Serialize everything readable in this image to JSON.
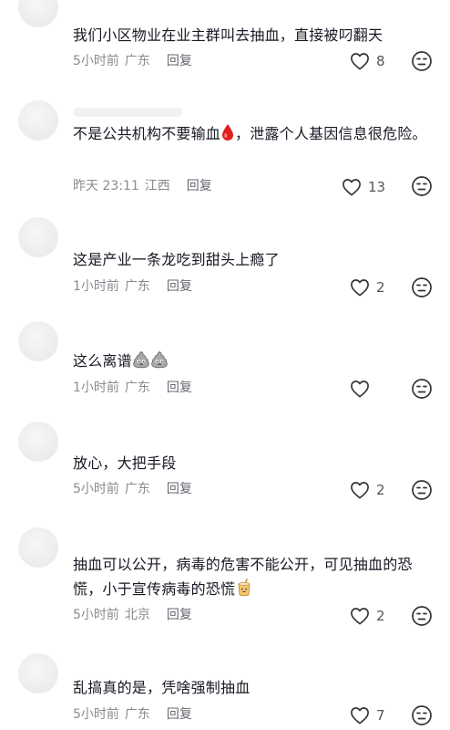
{
  "comments": [
    {
      "text": "我们小区物业在业主群叫去抽血，直接被叼翻天",
      "time": "5小时前",
      "location": "广东",
      "reply": "回复",
      "likes": "8"
    },
    {
      "text_before": "不是公共机构不要输血",
      "text_after": "，泄露个人基因信息很危险。",
      "time": "昨天 23:11",
      "location": "江西",
      "reply": "回复",
      "likes": "13"
    },
    {
      "text": "这是产业一条龙吃到甜头上瘾了",
      "time": "1小时前",
      "location": "广东",
      "reply": "回复",
      "likes": "2"
    },
    {
      "text": "这么离谱",
      "time": "1小时前",
      "location": "广东",
      "reply": "回复",
      "likes": ""
    },
    {
      "text": "放心，大把手段",
      "time": "5小时前",
      "location": "广东",
      "reply": "回复",
      "likes": "2"
    },
    {
      "text": "抽血可以公开，病毒的危害不能公开，可见抽血的恐慌，小于宣传病毒的恐慌",
      "time": "5小时前",
      "location": "北京",
      "reply": "回复",
      "likes": "2"
    },
    {
      "text": "乱搞真的是，凭啥强制抽血",
      "time": "5小时前",
      "location": "广东",
      "reply": "回复",
      "likes": "7"
    }
  ],
  "icons": {
    "like": "heart-outline-icon",
    "dislike": "unimpressed-face-icon",
    "blood": "blood-drop-emoji",
    "poo": "poop-emoji",
    "tea": "bubble-tea-emoji"
  },
  "colors": {
    "text": "#161823",
    "meta": "#8a8b91",
    "icon": "#333333",
    "blood": "#e0201c"
  }
}
